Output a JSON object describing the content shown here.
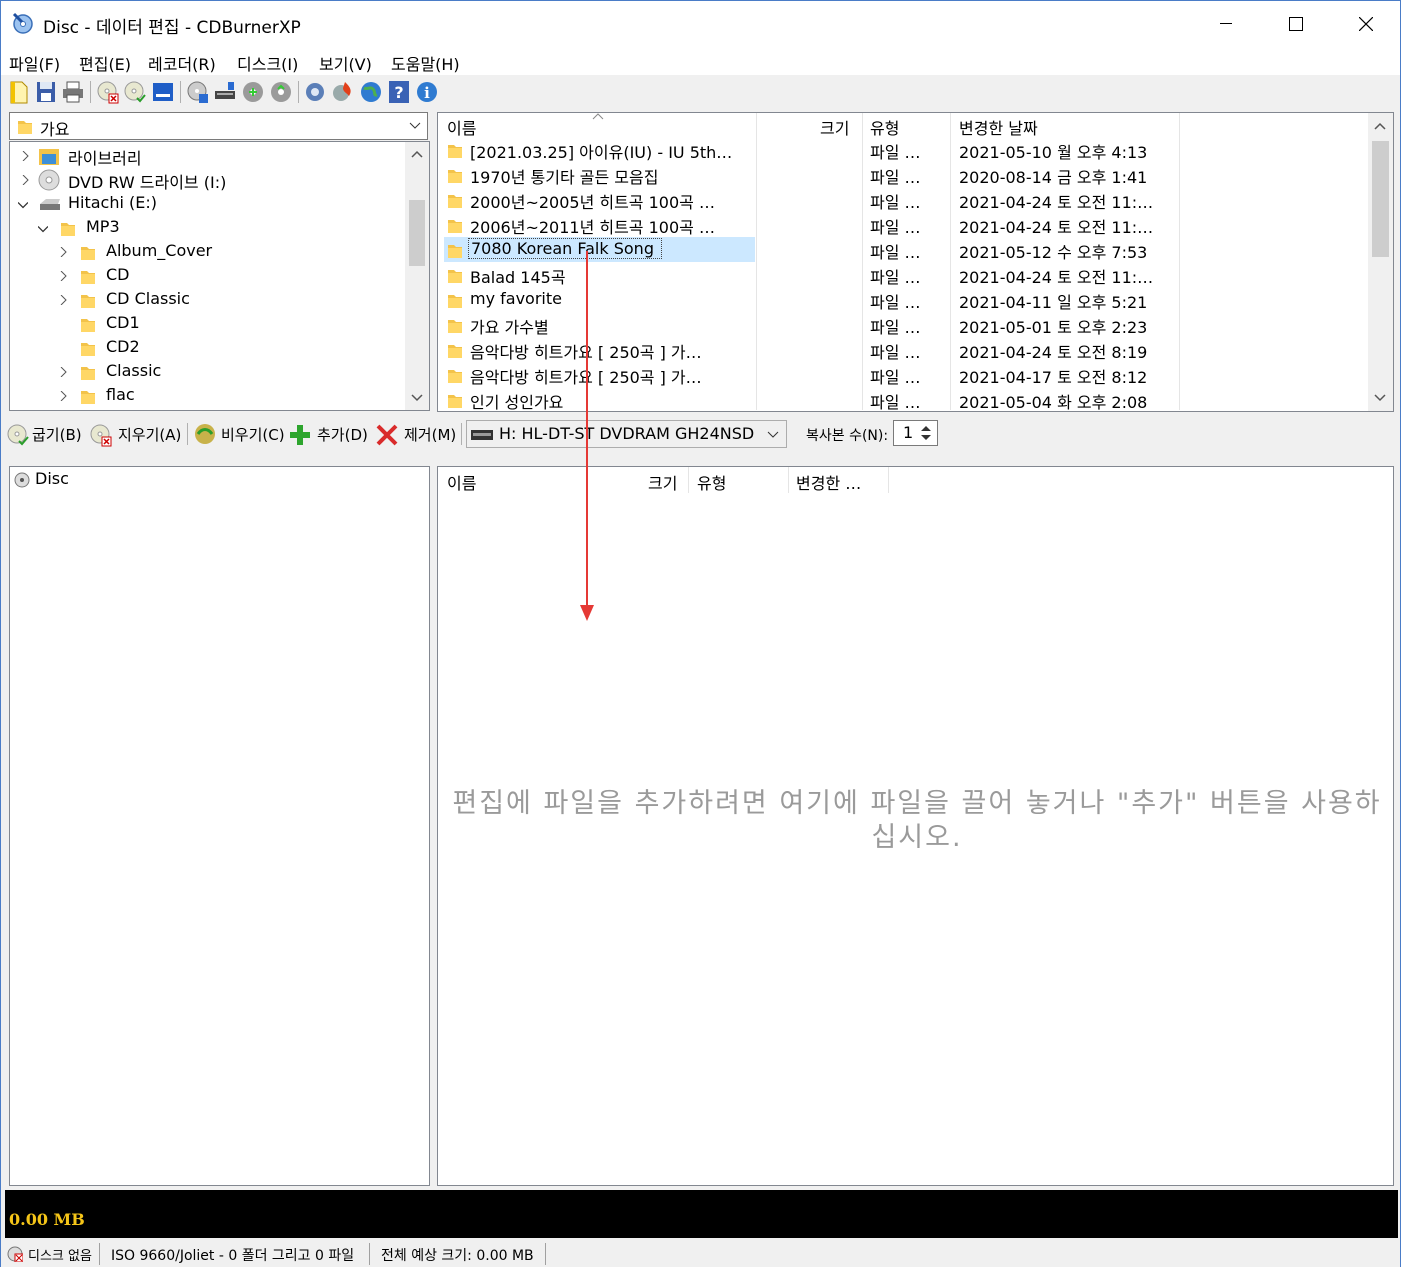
{
  "window": {
    "title": "Disc - 데이터 편집 - CDBurnerXP"
  },
  "menu": [
    "파일(F)",
    "편집(E)",
    "레코더(R)",
    "디스크(I)",
    "보기(V)",
    "도움말(H)"
  ],
  "location_combo": {
    "value": "가요"
  },
  "tree": [
    {
      "label": "라이브러리",
      "icon": "library-icon"
    },
    {
      "label": "DVD RW 드라이브 (I:)",
      "icon": "dvd-drive-icon"
    },
    {
      "label": "Hitachi (E:)",
      "icon": "hard-drive-icon"
    },
    {
      "label": "MP3",
      "icon": "folder-icon"
    },
    {
      "label": "Album_Cover",
      "icon": "folder-icon"
    },
    {
      "label": "CD",
      "icon": "folder-icon"
    },
    {
      "label": "CD Classic",
      "icon": "folder-icon"
    },
    {
      "label": "CD1",
      "icon": "folder-icon"
    },
    {
      "label": "CD2",
      "icon": "folder-icon"
    },
    {
      "label": "Classic",
      "icon": "folder-icon"
    },
    {
      "label": "flac",
      "icon": "folder-icon"
    }
  ],
  "file_list": {
    "columns": [
      "이름",
      "크기",
      "유형",
      "변경한 날짜"
    ],
    "rows": [
      {
        "name": "[2021.03.25] 아이유(IU) - IU 5th…",
        "type": "파일 …",
        "modified": "2021-05-10 월 오후 4:13"
      },
      {
        "name": "1970년 통기타 골든 모음집",
        "type": "파일 …",
        "modified": "2020-08-14 금 오후 1:41"
      },
      {
        "name": "2000년~2005년 히트곡 100곡 …",
        "type": "파일 …",
        "modified": "2021-04-24 토 오전 11:…"
      },
      {
        "name": "2006년~2011년 히트곡 100곡 …",
        "type": "파일 …",
        "modified": "2021-04-24 토 오전 11:…"
      },
      {
        "name": "7080 Korean Falk Song",
        "type": "파일 …",
        "modified": "2021-05-12 수 오후 7:53",
        "selected": true
      },
      {
        "name": "Balad 145곡",
        "type": "파일 …",
        "modified": "2021-04-24 토 오전 11:…"
      },
      {
        "name": "my favorite",
        "type": "파일 …",
        "modified": "2021-04-11 일 오후 5:21"
      },
      {
        "name": "가요 가수별",
        "type": "파일 …",
        "modified": "2021-05-01 토 오후 2:23"
      },
      {
        "name": "음악다방 히트가요 [ 250곡 ] 가…",
        "type": "파일 …",
        "modified": "2021-04-24 토 오전 8:19"
      },
      {
        "name": "음악다방 히트가요 [ 250곡 ] 가…",
        "type": "파일 …",
        "modified": "2021-04-17 토 오전 8:12"
      },
      {
        "name": "인기 성인가요",
        "type": "파일 …",
        "modified": "2021-05-04 화 오후 2:08"
      }
    ]
  },
  "actions": {
    "burn": "굽기(B)",
    "erase": "지우기(A)",
    "clear": "비우기(C)",
    "add": "추가(D)",
    "remove": "제거(M)",
    "drive": "H: HL-DT-ST DVDRAM GH24NSD",
    "copies_label": "복사본 수(N):",
    "copies_value": "1"
  },
  "compilation": {
    "root": "Disc",
    "columns": [
      "이름",
      "크기",
      "유형",
      "변경한 …"
    ],
    "drop_hint": "편집에 파일을 추가하려면 여기에 파일을 끌어 놓거나 \"추가\" 버튼을 사용하십시오."
  },
  "capacity": {
    "used": "0.00 MB"
  },
  "status": {
    "disc": "디스크 없음",
    "fs": "ISO 9660/Joliet - 0 폴더 그리고 0 파일",
    "total": "전체 예상 크기: 0.00 MB"
  },
  "colors": {
    "selection": "#cce8ff",
    "capacity_text": "#f5c518",
    "arrow": "#e53935"
  }
}
